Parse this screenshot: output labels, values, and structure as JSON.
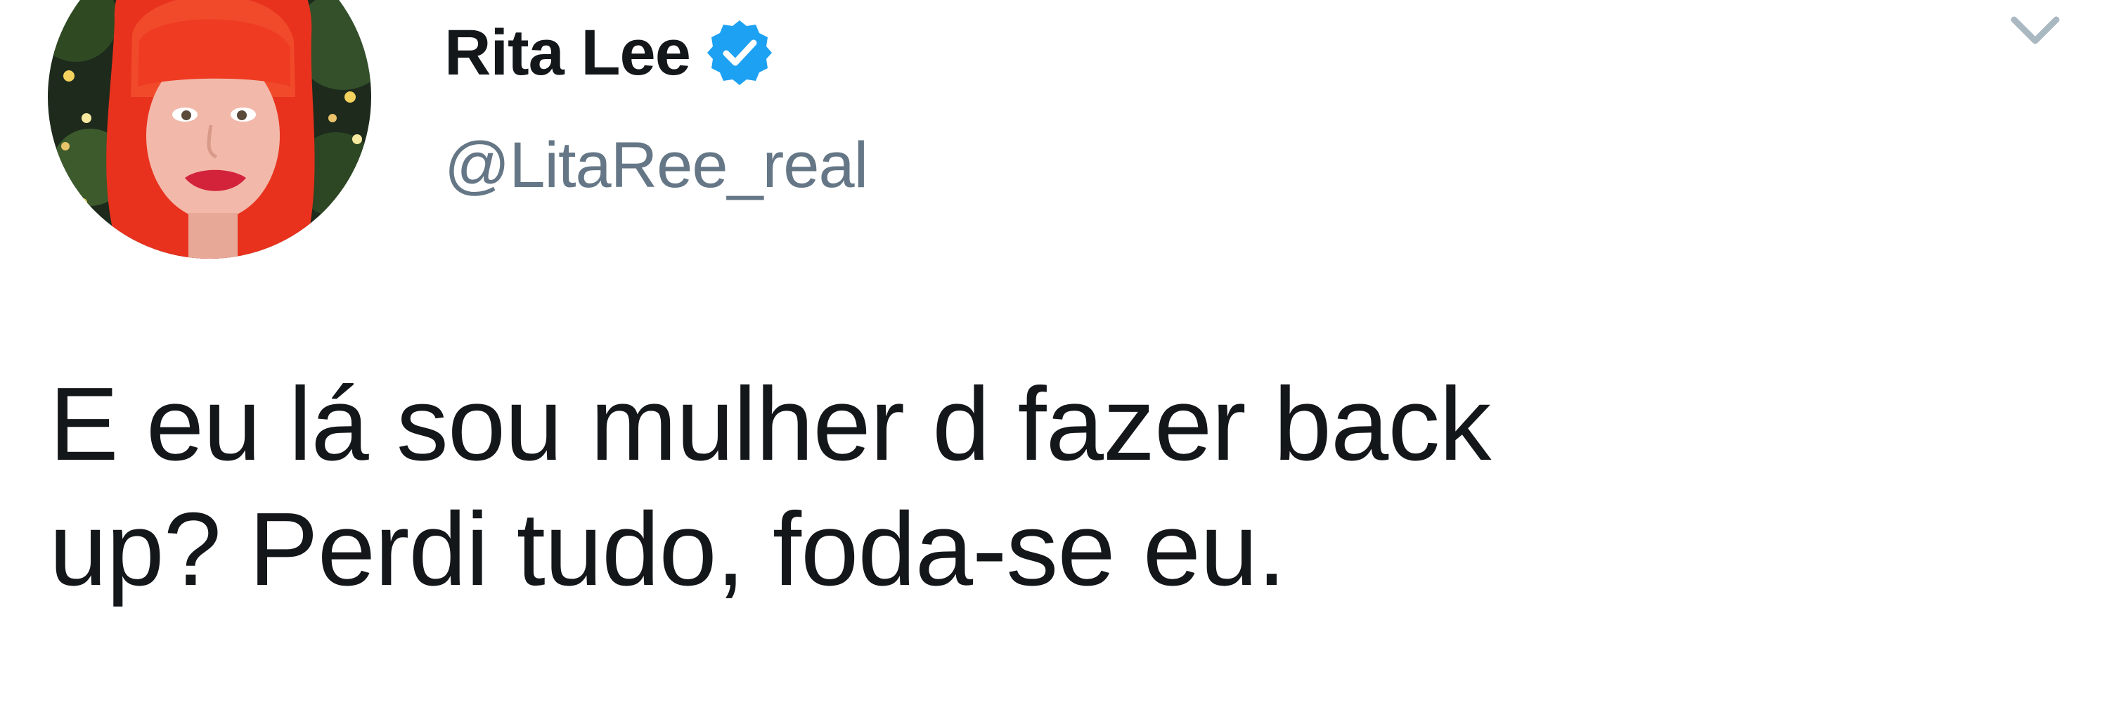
{
  "tweet": {
    "author": {
      "display_name": "Rita Lee",
      "handle": "@LitaRee_real",
      "verified": true,
      "avatar_icon": "profile-photo-red-hair"
    },
    "menu_icon": "chevron-down-icon",
    "text_lines": [
      "E eu lá sou mulher d fazer back",
      "up? Perdi tudo, foda-se eu."
    ]
  },
  "colors": {
    "text_primary": "#14171a",
    "text_secondary": "#657786",
    "verified_blue": "#1da1f2",
    "caret_gray": "#aab8c2"
  }
}
